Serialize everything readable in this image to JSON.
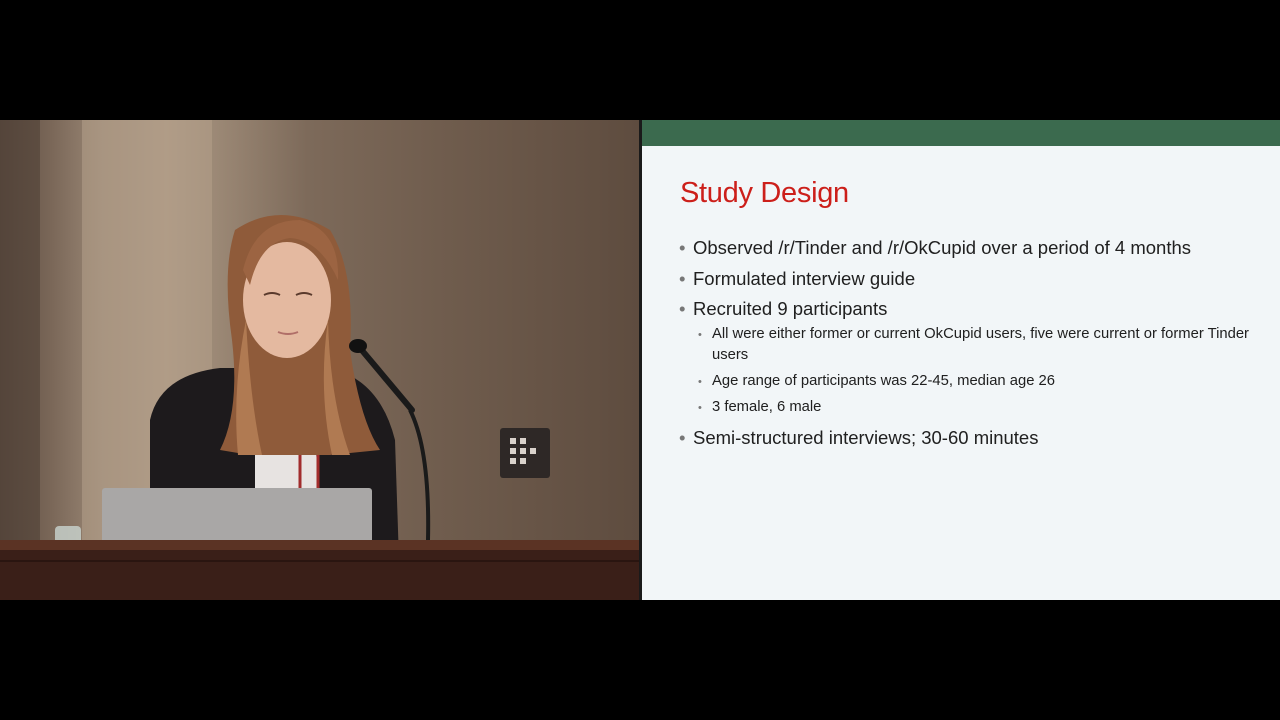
{
  "slide": {
    "title": "Study Design",
    "bullets": [
      {
        "text": "Observed /r/Tinder and /r/OkCupid over a period of  4 months"
      },
      {
        "text": "Formulated interview guide"
      },
      {
        "text": "Recruited 9 participants",
        "sub": [
          "All were either former or current OkCupid users, five were current or former Tinder users",
          "Age range of participants was 22-45, median age 26",
          "3 female, 6 male"
        ]
      },
      {
        "text": "Semi-structured interviews; 30-60 minutes"
      }
    ],
    "bullet_glyph": "•",
    "colors": {
      "title": "#cc1f1a",
      "band": "#3b6a4e",
      "background": "#f2f6f8"
    }
  },
  "video": {
    "subject": "speaker at podium with laptop and microphone"
  }
}
